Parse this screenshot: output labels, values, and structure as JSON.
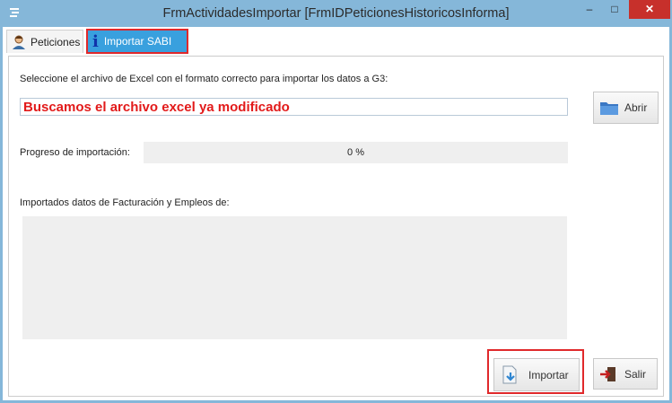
{
  "window": {
    "title": "FrmActividadesImportar [FrmIDPeticionesHistoricosInforma]",
    "minimize": "–",
    "maximize": "□",
    "close": "✕"
  },
  "tabs": [
    {
      "label": "Peticiones"
    },
    {
      "label": "Importar SABI"
    }
  ],
  "main": {
    "select_file_label": "Seleccione el archivo de Excel con el formato correcto para importar los datos a G3:",
    "file_value": "Buscamos el archivo excel ya modificado",
    "open_button": "Abrir",
    "progress_label": "Progreso de importación:",
    "progress_text": "0 %",
    "progress_value": 0,
    "imported_label": "Importados datos de Facturación y Empleos de:",
    "import_button": "Importar",
    "exit_button": "Salir"
  },
  "colors": {
    "title_bg": "#85b7d9",
    "active_tab": "#39a0de",
    "highlight": "#e0292b",
    "file_text": "#e21a1a"
  }
}
